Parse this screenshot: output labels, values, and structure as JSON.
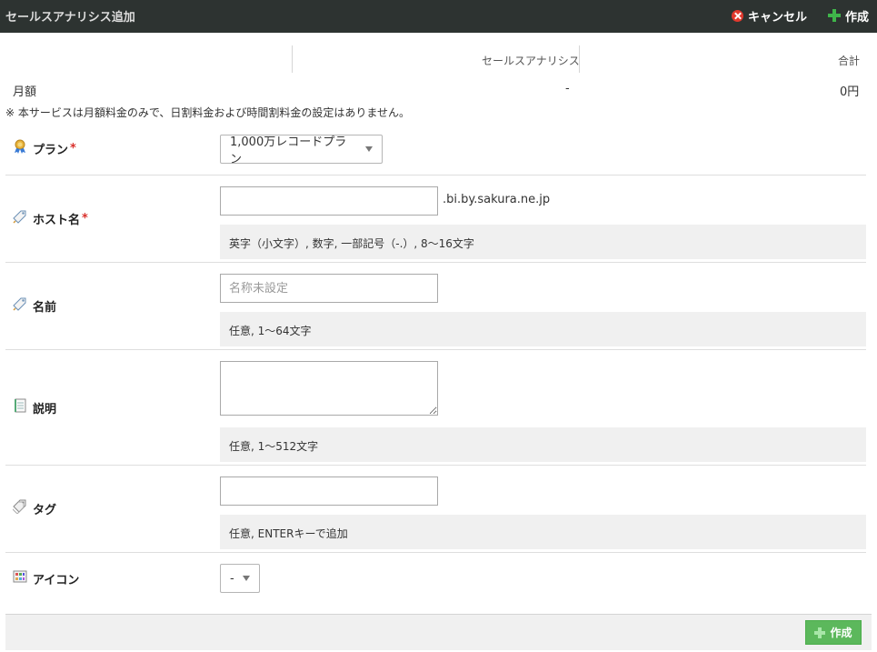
{
  "header": {
    "title": "セールスアナリシス追加",
    "cancel_label": "キャンセル",
    "create_label": "作成"
  },
  "pricing": {
    "product_header": "セールスアナリシス",
    "total_header": "合計",
    "row_label": "月額",
    "row_value": "-",
    "row_total": "0円",
    "notice": "※ 本サービスは月額料金のみで、日割料金および時間割料金の設定はありません。"
  },
  "form": {
    "plan": {
      "label": "プラン",
      "required": "*",
      "value": "1,000万レコードプラン",
      "icon": "award-ribbon-icon"
    },
    "hostname": {
      "label": "ホスト名",
      "required": "*",
      "value": "",
      "suffix": ".bi.by.sakura.ne.jp",
      "hint": "英字（小文字）, 数字, 一部記号（-.）, 8〜16文字",
      "icon": "tag-label-icon"
    },
    "name": {
      "label": "名前",
      "placeholder": "名称未設定",
      "hint": "任意, 1〜64文字",
      "icon": "tag-label-icon"
    },
    "description": {
      "label": "説明",
      "hint": "任意, 1〜512文字",
      "icon": "notepad-icon"
    },
    "tags": {
      "label": "タグ",
      "hint": "任意, ENTERキーで追加",
      "icon": "tags-icon"
    },
    "icon": {
      "label": "アイコン",
      "value": "-",
      "icon": "icon-grid-icon"
    }
  },
  "footer": {
    "create_label": "作成"
  },
  "colors": {
    "titlebar": "#2d3331",
    "accent_green": "#5cb85c",
    "cancel_red": "#e0392e",
    "required_red": "#d9302b",
    "hint_bg": "#f0f0f0"
  }
}
